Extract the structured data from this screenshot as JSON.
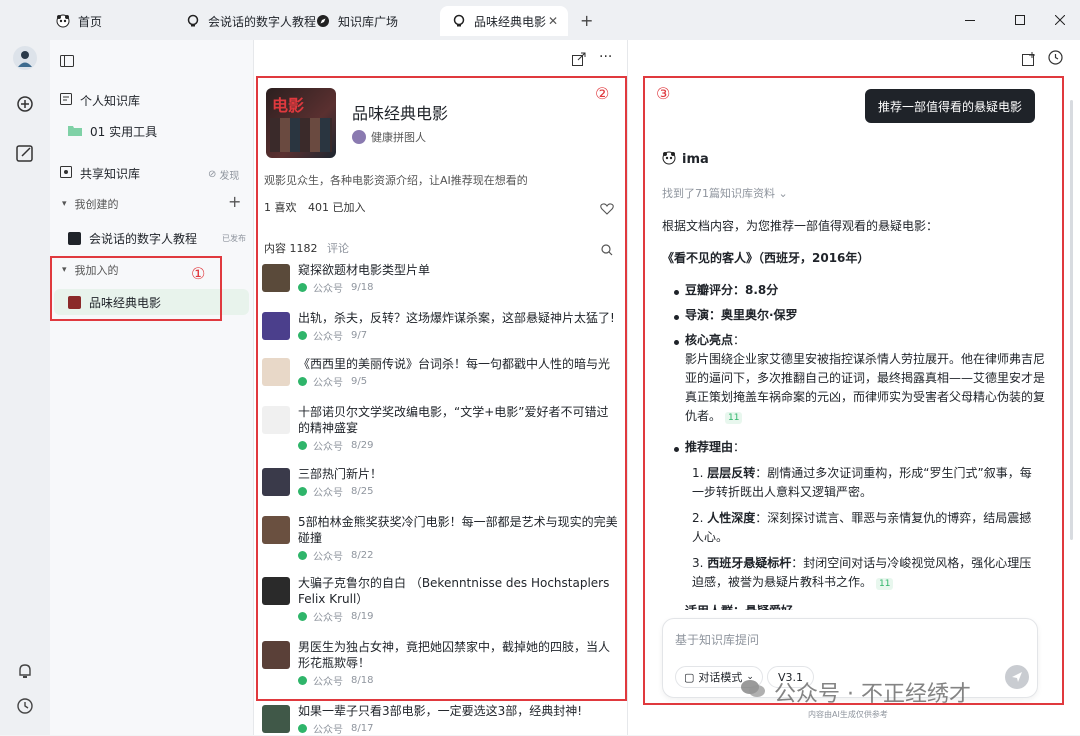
{
  "tabs": [
    {
      "label": "首页",
      "icon": "panda-icon"
    },
    {
      "label": "会说话的数字人教程",
      "icon": "bulb-icon"
    },
    {
      "label": "知识库广场",
      "icon": "compass-icon"
    },
    {
      "label": "品味经典电影",
      "icon": "bulb-icon"
    }
  ],
  "sidebar": {
    "personal_kb": "个人知识库",
    "folder": "01 实用工具",
    "shared_kb": "共享知识库",
    "discover": "发现",
    "created_section": "我创建的",
    "created_item": "会说话的数字人教程",
    "created_item_status": "已发布",
    "joined_section": "我加入的",
    "joined_item": "品味经典电影"
  },
  "kb": {
    "title": "品味经典电影",
    "author": "健康拼图人",
    "description": "观影见众生，各种电影资源介绍，让AI推荐现在想看的",
    "likes": "1 喜欢",
    "joined": "401 已加入",
    "content_tab": "内容 1182",
    "comments_tab": "评论",
    "cover_text": "电影"
  },
  "items": [
    {
      "title": "窥探欲题材电影类型片单",
      "source": "公众号",
      "date": "9/18",
      "color": "#5a4a3a"
    },
    {
      "title": "出轨，杀夫，反转？这场爆炸谋杀案，这部悬疑神片太猛了!",
      "source": "公众号",
      "date": "9/7",
      "color": "#4b3f8c"
    },
    {
      "title": "《西西里的美丽传说》台词杀！每一句都戳中人性的暗与光",
      "source": "公众号",
      "date": "9/5",
      "color": "#e8d8c8"
    },
    {
      "title": "十部诺贝尔文学奖改编电影，“文学+电影”爱好者不可错过的精神盛宴",
      "source": "公众号",
      "date": "8/29",
      "color": "#f0f0f0"
    },
    {
      "title": "三部热门新片！",
      "source": "公众号",
      "date": "8/25",
      "color": "#3a3a4a"
    },
    {
      "title": "5部柏林金熊奖获奖冷门电影！每一部都是艺术与现实的完美碰撞",
      "source": "公众号",
      "date": "8/22",
      "color": "#6a5040"
    },
    {
      "title": "大骗子克鲁尔的自白 （Bekenntnisse des Hochstaplers Felix Krull）",
      "source": "公众号",
      "date": "8/19",
      "color": "#2a2a2a"
    },
    {
      "title": "男医生为独占女神，竟把她囚禁家中，截掉她的四肢，当人形花瓶欺辱！",
      "source": "公众号",
      "date": "8/18",
      "color": "#5a4038"
    },
    {
      "title": "如果一辈子只看3部电影，一定要选这3部，经典封神!",
      "source": "公众号",
      "date": "8/17",
      "color": "#405848"
    }
  ],
  "chat": {
    "user_message": "推荐一部值得看的悬疑电影",
    "bot_name": "ima",
    "found_refs": "找到了71篇知识库资料",
    "intro": "根据文档内容，为您推荐一部值得观看的悬疑电影：",
    "movie_title": "《看不见的客人》（西班牙，2016年）",
    "rating_label": "豆瓣评分：8.8分",
    "director_label": "导演：奥里奥尔·保罗",
    "highlights_label": "核心亮点",
    "highlights_text": "影片围绕企业家艾德里安被指控谋杀情人劳拉展开。他在律师弗吉尼亚的逼问下，多次推翻自己的证词，最终揭露真相——艾德里安才是真正策划掩盖车祸命案的元凶，而律师实为受害者父母精心伪装的复仇者。",
    "ref_badge": "11",
    "reasons_label": "推荐理由",
    "reasons": [
      {
        "title": "层层反转",
        "text": "剧情通过多次证词重构，形成“罗生门式”叙事，每一步转折既出人意料又逻辑严密。"
      },
      {
        "title": "人性深度",
        "text": "深刻探讨谎言、罪恶与亲情复仇的博弈，结局震撼人心。"
      },
      {
        "title": "西班牙悬疑标杆",
        "text": "封闭空间对话与冷峻视觉风格，强化心理压迫感，被誉为悬疑片教科书之作。"
      }
    ],
    "truncated_line": "适用人群：悬疑爱好",
    "input_placeholder": "基于知识库提问",
    "mode_label": "对话模式",
    "version_label": "V3.1",
    "disclaimer": "内容由AI生成仅供参考"
  },
  "watermark": "公众号 · 不正经绣才",
  "annotations": [
    "①",
    "②",
    "③"
  ],
  "colors": {
    "accent": "#2fb56a",
    "annotation": "#e0393e",
    "dark_button": "#1f2329"
  }
}
